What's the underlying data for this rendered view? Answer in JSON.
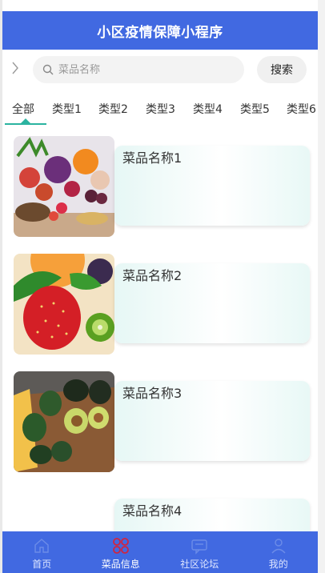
{
  "header": {
    "title": "小区疫情保障小程序"
  },
  "search": {
    "placeholder": "菜品名称",
    "value": "",
    "button_label": "搜索"
  },
  "tabs": [
    {
      "label": "全部",
      "active": true
    },
    {
      "label": "类型1"
    },
    {
      "label": "类型2"
    },
    {
      "label": "类型3"
    },
    {
      "label": "类型4"
    },
    {
      "label": "类型5"
    },
    {
      "label": "类型6"
    }
  ],
  "items": [
    {
      "name": "菜品名称1",
      "image": "mixed-vegetables-photo"
    },
    {
      "name": "菜品名称2",
      "image": "strawberry-fruit-photo"
    },
    {
      "name": "菜品名称3",
      "image": "avocado-photo"
    },
    {
      "name": "菜品名称4",
      "image": ""
    }
  ],
  "bottom_nav": [
    {
      "label": "首页",
      "icon": "home-icon",
      "active": false
    },
    {
      "label": "菜品信息",
      "icon": "dishes-grid-icon",
      "active": true
    },
    {
      "label": "社区论坛",
      "icon": "forum-chat-icon",
      "active": false
    },
    {
      "label": "我的",
      "icon": "user-icon",
      "active": false
    }
  ],
  "colors": {
    "primary": "#4169e1",
    "accent": "#2bb3a0",
    "active_icon": "#d0253f"
  }
}
